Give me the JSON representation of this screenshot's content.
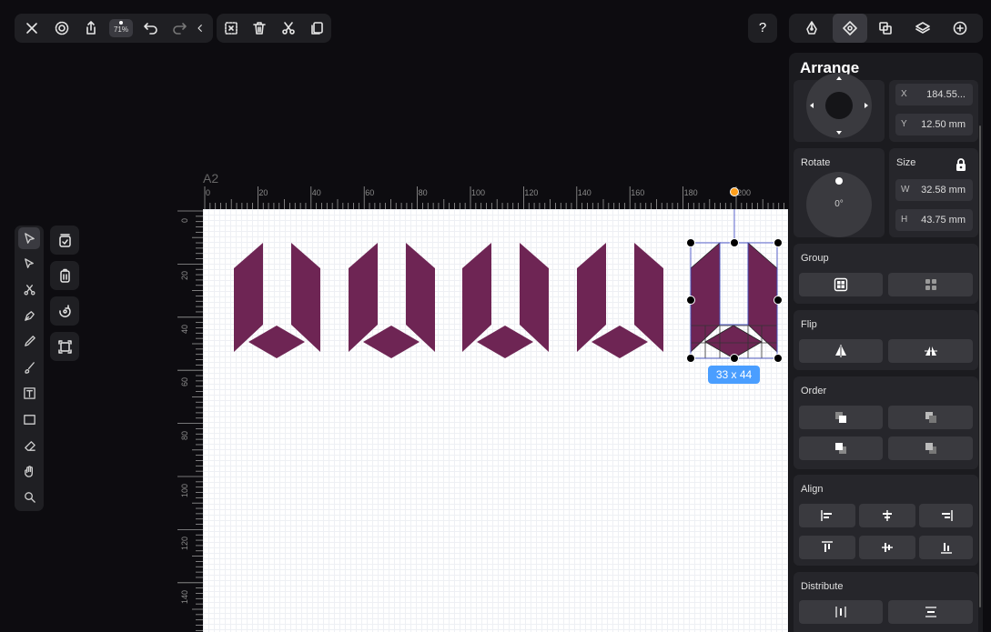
{
  "toolbar": {
    "zoom_label": "71%",
    "icons": [
      "close-icon",
      "settings-icon",
      "share-icon",
      "undo-icon",
      "redo-icon",
      "collapse-icon",
      "deselect-icon",
      "trash-icon",
      "cut-icon",
      "copy-icon"
    ]
  },
  "help_label": "?",
  "document": {
    "name": "A2",
    "ruler_top_labels": [
      "0",
      "20",
      "40",
      "60",
      "80",
      "100",
      "120",
      "140",
      "160",
      "180",
      "200"
    ],
    "ruler_left_labels": [
      "0",
      "20",
      "40",
      "60",
      "80",
      "100",
      "120",
      "140"
    ]
  },
  "selection": {
    "size_label": "33 x 44"
  },
  "panel": {
    "title": "Arrange",
    "position": {
      "x_key": "X",
      "x_value": "184.55...",
      "y_key": "Y",
      "y_value": "12.50 mm"
    },
    "rotate": {
      "title": "Rotate",
      "value": "0°"
    },
    "size": {
      "title": "Size",
      "w_key": "W",
      "w_value": "32.58 mm",
      "h_key": "H",
      "h_value": "43.75 mm"
    },
    "group_title": "Group",
    "flip_title": "Flip",
    "order_title": "Order",
    "align_title": "Align",
    "distribute_title": "Distribute"
  },
  "colors": {
    "shape_fill": "#6e2554",
    "accent": "#4a9eff",
    "handle": "#000000",
    "rotate_handle": "#ff9f1c"
  }
}
